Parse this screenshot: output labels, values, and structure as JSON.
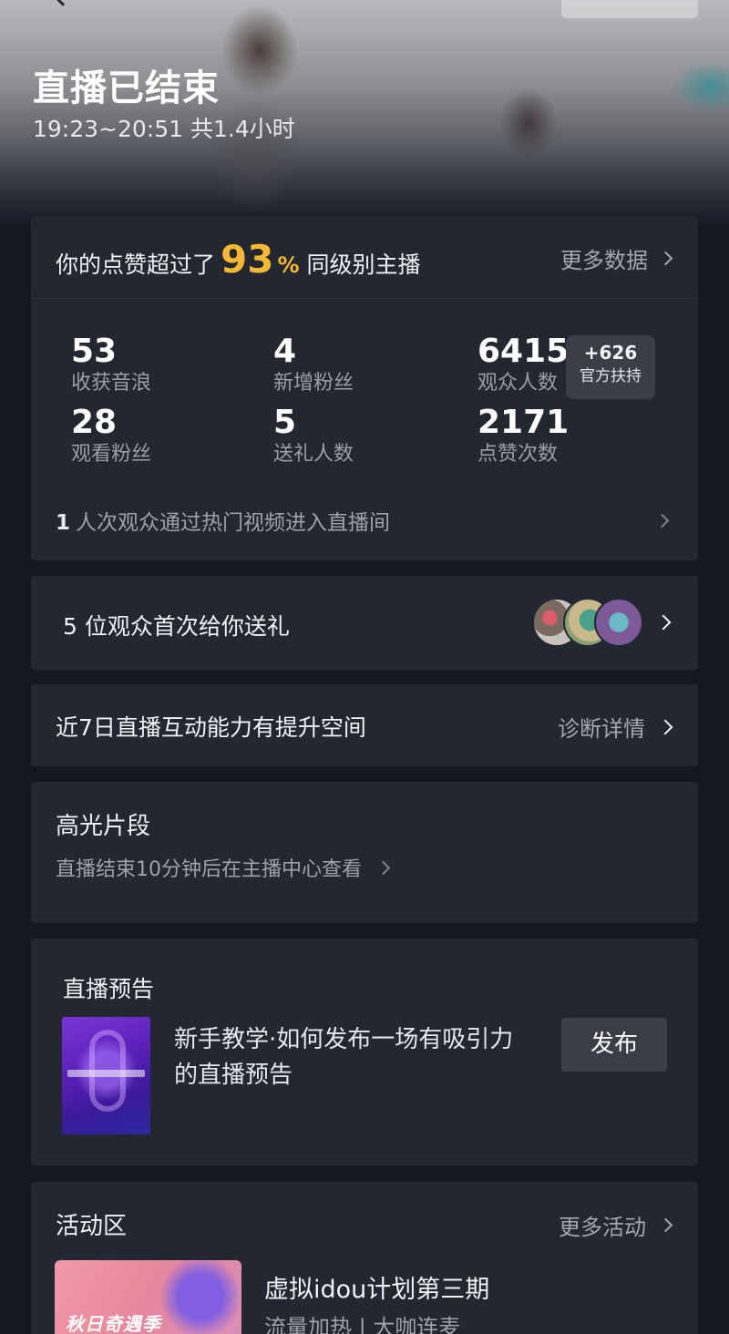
{
  "header": {
    "title": "直播已结束",
    "time_range": "19:23~20:51 共1.4小时"
  },
  "likes_card": {
    "prefix": "你的点赞超过了",
    "percent": "93",
    "percent_sign": "%",
    "suffix": "同级别主播",
    "more_label": "更多数据",
    "stats": [
      {
        "value": "53",
        "label": "收获音浪"
      },
      {
        "value": "4",
        "label": "新增粉丝"
      },
      {
        "value": "6415",
        "label": "观众人数"
      },
      {
        "value": "28",
        "label": "观看粉丝"
      },
      {
        "value": "5",
        "label": "送礼人数"
      },
      {
        "value": "2171",
        "label": "点赞次数"
      }
    ],
    "boost": {
      "value": "+626",
      "label": "官方扶持"
    },
    "hot_count": "1",
    "hot_text": "人次观众通过热门视频进入直播间"
  },
  "gift_card": {
    "text": "5 位观众首次给你送礼"
  },
  "interaction_card": {
    "text": "近7日直播互动能力有提升空间",
    "link": "诊断详情"
  },
  "highlight_card": {
    "title": "高光片段",
    "subtitle": "直播结束10分钟后在主播中心查看"
  },
  "preview_card": {
    "title": "直播预告",
    "description": "新手教学·如何发布一场有吸引力的直播预告",
    "publish_label": "发布"
  },
  "activity_card": {
    "title": "活动区",
    "more_label": "更多活动",
    "item_title": "虚拟idou计划第三期",
    "item_tags": "流量加热 | 大咖连麦",
    "banner_text": "秋日奇遇季"
  },
  "colors": {
    "accent": "#f5b82e",
    "background": "#141823",
    "card": "#232731"
  }
}
